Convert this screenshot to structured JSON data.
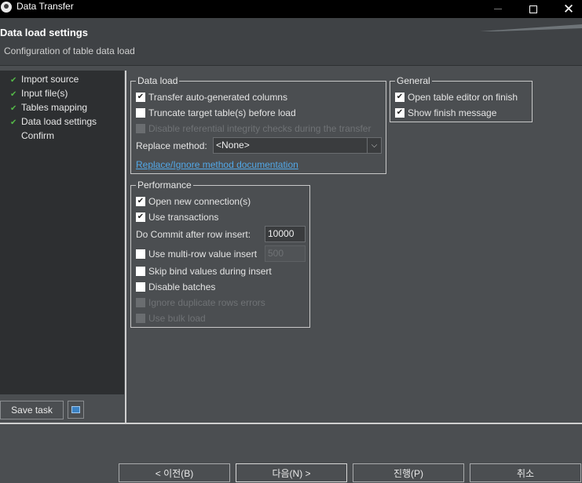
{
  "window": {
    "title": "Data Transfer"
  },
  "header": {
    "title": "Data load settings",
    "subtitle": "Configuration of table data load"
  },
  "nav": {
    "items": [
      {
        "label": "Import source",
        "done": true
      },
      {
        "label": "Input file(s)",
        "done": true
      },
      {
        "label": "Tables mapping",
        "done": true
      },
      {
        "label": "Data load settings",
        "done": true
      },
      {
        "label": "Confirm",
        "done": false
      }
    ],
    "save_task": "Save task",
    "print_icon": "print-icon"
  },
  "data_load": {
    "title": "Data load",
    "transfer_auto": {
      "label": "Transfer auto-generated columns",
      "checked": true
    },
    "truncate": {
      "label": "Truncate target table(s) before load",
      "checked": false
    },
    "disable_ref": {
      "label": "Disable referential integrity checks during the transfer",
      "checked": false,
      "enabled": false
    },
    "replace_label": "Replace method:",
    "replace_value": "<None>",
    "doc_link": "Replace/Ignore method documentation"
  },
  "general": {
    "title": "General",
    "open_editor": {
      "label": "Open table editor on finish",
      "checked": true
    },
    "show_finish": {
      "label": "Show finish message",
      "checked": true
    }
  },
  "performance": {
    "title": "Performance",
    "open_conn": {
      "label": "Open new connection(s)",
      "checked": true
    },
    "use_tx": {
      "label": "Use transactions",
      "checked": true
    },
    "commit_label": "Do Commit after row insert:",
    "commit_value": "10000",
    "multi_row": {
      "label": "Use multi-row value insert",
      "checked": false
    },
    "multi_row_value": "500",
    "skip_bind": {
      "label": "Skip bind values during insert",
      "checked": false
    },
    "disable_batches": {
      "label": "Disable batches",
      "checked": false
    },
    "ignore_dup": {
      "label": "Ignore duplicate rows errors",
      "checked": false,
      "enabled": false
    },
    "bulk_load": {
      "label": "Use bulk load",
      "checked": false,
      "enabled": false
    }
  },
  "buttons": {
    "prev": "< 이전(B)",
    "next": "다음(N) >",
    "proceed": "진행(P)",
    "cancel": "취소"
  }
}
